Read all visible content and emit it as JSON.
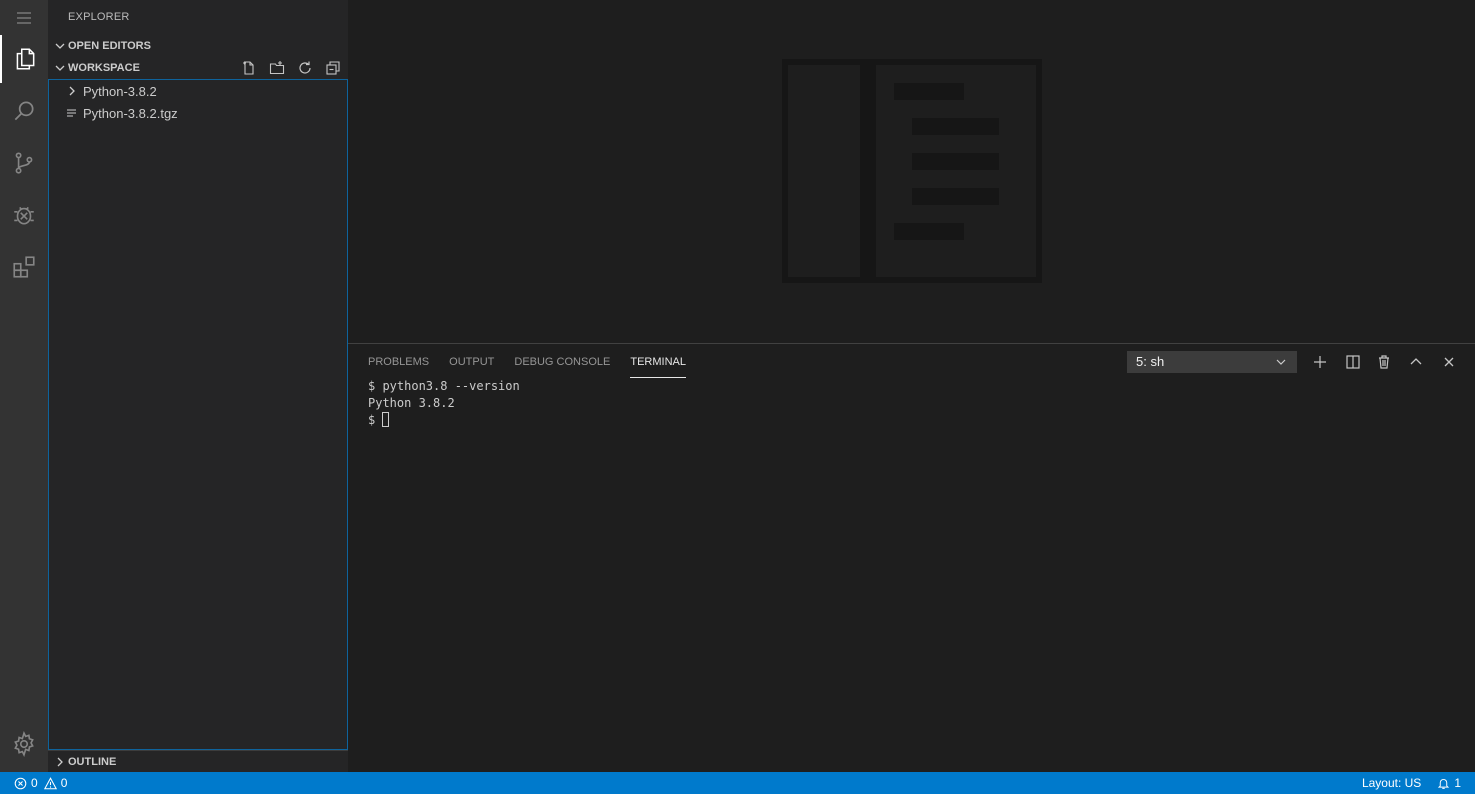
{
  "sidebar": {
    "title": "EXPLORER",
    "open_editors": "OPEN EDITORS",
    "workspace": "WORKSPACE",
    "outline": "OUTLINE",
    "tree": [
      {
        "label": "Python-3.8.2",
        "kind": "folder"
      },
      {
        "label": "Python-3.8.2.tgz",
        "kind": "file"
      }
    ]
  },
  "panel": {
    "tabs": [
      "PROBLEMS",
      "OUTPUT",
      "DEBUG CONSOLE",
      "TERMINAL"
    ],
    "active_tab": "TERMINAL",
    "terminal_select": "5: sh",
    "lines": [
      "$ python3.8 --version",
      "Python 3.8.2",
      "$ "
    ]
  },
  "status": {
    "errors": "0",
    "warnings": "0",
    "layout": "Layout: US",
    "notifications": "1"
  },
  "icons": {
    "activity": [
      "menu-icon",
      "files-icon",
      "search-icon",
      "source-control-icon",
      "debug-icon",
      "extensions-icon",
      "settings-gear-icon"
    ]
  },
  "colors": {
    "accent": "#007acc",
    "activity_bar": "#333333",
    "sidebar": "#252526",
    "editor": "#1e1e1e"
  }
}
